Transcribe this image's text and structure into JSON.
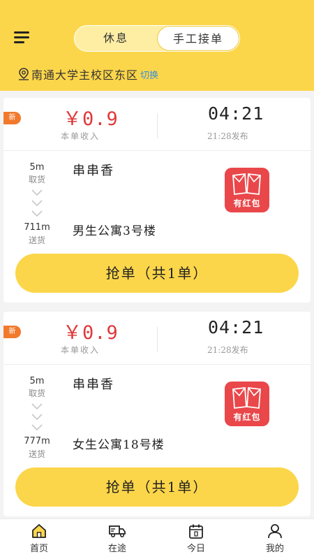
{
  "header": {
    "toggle": {
      "rest_label": "休息",
      "manual_label": "手工接单",
      "selected": "手工接单"
    },
    "location": {
      "name": "南通大学主校区东区",
      "switch_label": "切换"
    },
    "accent_color": "#fcd64a"
  },
  "orders": [
    {
      "badge": "新",
      "price": "￥0.9",
      "price_label": "本单收入",
      "time": "04:21",
      "time_label": "21:28发布",
      "pickup_distance": "5m",
      "pickup_label": "取货",
      "shop": "串串香",
      "dropoff_distance": "711m",
      "dropoff_label": "送货",
      "destination": "男生公寓3号楼",
      "red_packet_label": "有红包",
      "grab_label": "抢单（共1单）"
    },
    {
      "badge": "新",
      "price": "￥0.9",
      "price_label": "本单收入",
      "time": "04:21",
      "time_label": "21:28发布",
      "pickup_distance": "5m",
      "pickup_label": "取货",
      "shop": "串串香",
      "dropoff_distance": "777m",
      "dropoff_label": "送货",
      "destination": "女生公寓18号楼",
      "red_packet_label": "有红包",
      "grab_label": "抢单（共1单）"
    }
  ],
  "bottom_nav": {
    "items": [
      {
        "label": "首页",
        "icon": "home-icon",
        "active": true
      },
      {
        "label": "在途",
        "icon": "truck-icon",
        "active": false
      },
      {
        "label": "今日",
        "icon": "calendar-icon",
        "active": false
      },
      {
        "label": "我的",
        "icon": "user-icon",
        "active": false
      }
    ]
  },
  "colors": {
    "price": "#e0383a",
    "badge": "#f2792b",
    "red_packet": "#e9474a",
    "link": "#3a8fd8"
  }
}
